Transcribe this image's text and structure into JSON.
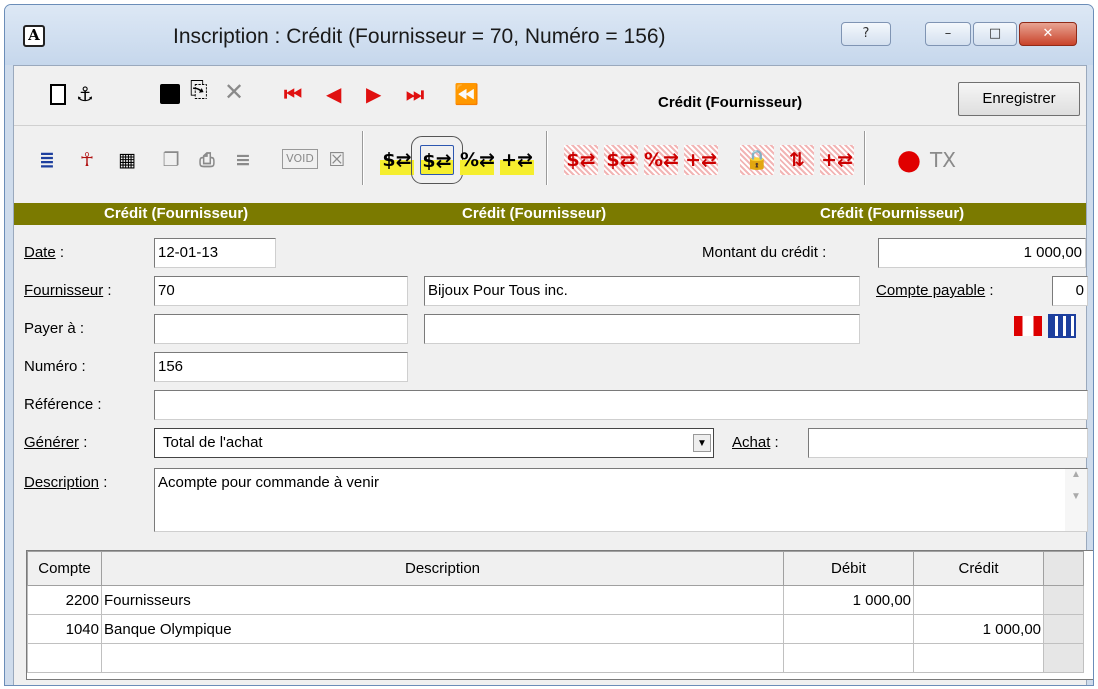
{
  "window": {
    "title": "Inscription : Crédit (Fournisseur = 70, Numéro = 156)",
    "app_icon_letter": "A",
    "help_btn": "?",
    "minimize_btn": "–",
    "maximize_btn": "□",
    "close_btn": "✕"
  },
  "nav": {
    "title": "Crédit (Fournisseur)",
    "save_label": "Enregistrer"
  },
  "toolbar": {
    "void_label": "VOID",
    "tx_label": "TX"
  },
  "banner": {
    "left": "Crédit (Fournisseur)",
    "center": "Crédit (Fournisseur)",
    "right": "Crédit (Fournisseur)"
  },
  "form": {
    "date_label": "Date",
    "date_value": "12-01-13",
    "amount_label": "Montant du crédit :",
    "amount_value": "1 000,00",
    "supplier_label": "Fournisseur",
    "supplier_value": "70",
    "supplier_name": "Bijoux Pour Tous inc.",
    "payable_label": "Compte payable",
    "payable_value": "0",
    "pay_to_label": "Payer à :",
    "pay_to_value": "",
    "pay_to_value2": "",
    "number_label": "Numéro :",
    "number_value": "156",
    "reference_label": "Référence :",
    "reference_value": "",
    "generate_label": "Générer",
    "generate_value": "Total de l'achat",
    "purchase_label": "Achat",
    "purchase_value": "",
    "description_label": "Description",
    "description_value": "Acompte pour commande à venir"
  },
  "grid": {
    "headers": [
      "Compte",
      "Description",
      "Débit",
      "Crédit"
    ],
    "rows": [
      [
        "2200",
        "Fournisseurs",
        "1 000,00",
        ""
      ],
      [
        "1040",
        "Banque Olympique",
        "",
        "1 000,00"
      ],
      [
        "",
        "",
        "",
        ""
      ]
    ]
  },
  "colors": {
    "banner": "#7b7a00",
    "nav_red": "#e01010",
    "record_red": "#e00000"
  }
}
